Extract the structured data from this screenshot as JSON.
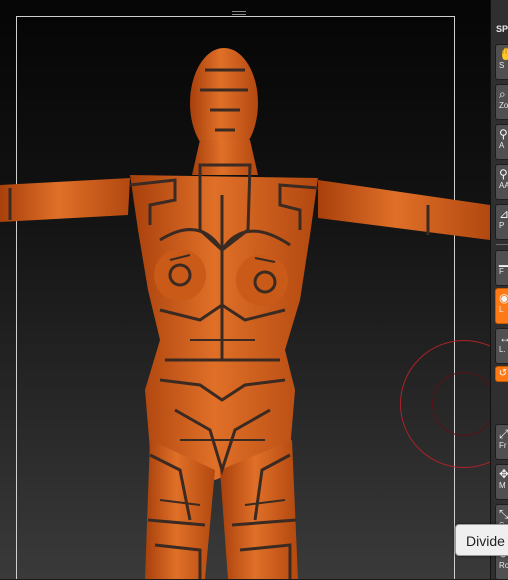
{
  "viewport": {
    "background_top": "#050505",
    "background_bottom": "#3a3a3a",
    "frame_color": "#cfcfcf",
    "model_color": "#d9651f",
    "model_shade": "#b54810",
    "pattern_color": "#3a2a22"
  },
  "brush": {
    "outer_color": "#b0212a",
    "inner_color": "#5a1116"
  },
  "shelf": {
    "section_label": "SP",
    "buttons": [
      {
        "icon": "hand-icon",
        "glyph": "✋",
        "label": "S"
      },
      {
        "icon": "zoom-icon",
        "glyph": "⌕",
        "label": "Zo"
      },
      {
        "icon": "actual-icon",
        "glyph": "⚲",
        "label": "A"
      },
      {
        "icon": "aahalf-icon",
        "glyph": "⚲",
        "label": "AA"
      },
      {
        "icon": "persp-icon",
        "glyph": "⊿",
        "label": "P"
      },
      {
        "icon": "floor-icon",
        "glyph": "▁",
        "label": "F"
      },
      {
        "icon": "local-icon",
        "glyph": "◉",
        "label": "L"
      },
      {
        "icon": "lsym-icon",
        "glyph": "↔",
        "label": "L."
      },
      {
        "icon": "frame-icon",
        "glyph": "⤢",
        "label": "Fr"
      },
      {
        "icon": "move-icon",
        "glyph": "✥",
        "label": "M"
      },
      {
        "icon": "scale-icon",
        "glyph": "⤡",
        "label": "S"
      },
      {
        "icon": "rotate-icon",
        "glyph": "⟳",
        "label": "Ro"
      }
    ],
    "toggle_glyph": "↺"
  },
  "tooltip": {
    "text": "Divide"
  }
}
